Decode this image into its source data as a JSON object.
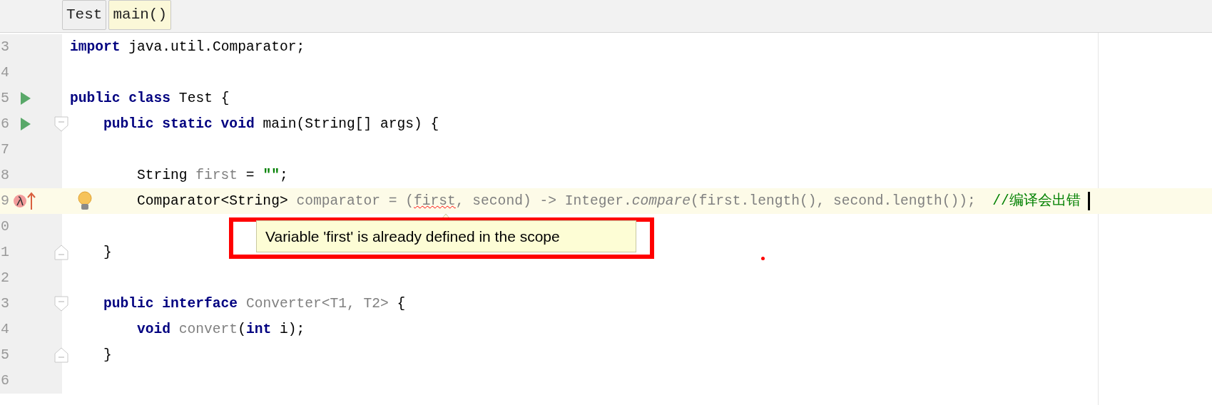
{
  "breadcrumbs": [
    {
      "label": "Test",
      "selected": false
    },
    {
      "label": "main()",
      "selected": true
    }
  ],
  "lines": [
    {
      "number": "3",
      "current": false,
      "tokens": [
        {
          "kind": "keyword",
          "text": "import"
        },
        {
          "kind": "plain",
          "text": " java.util.Comparator;"
        }
      ]
    },
    {
      "number": "4",
      "current": false
    },
    {
      "number": "5",
      "current": false,
      "gutter": [
        {
          "kind": "run"
        }
      ],
      "tokens": [
        {
          "kind": "keyword",
          "text": "public class"
        },
        {
          "kind": "plain",
          "text": " Test {"
        }
      ],
      "children": [
        {
          "number": "6",
          "current": false,
          "gutter": [
            {
              "kind": "run"
            },
            {
              "kind": "fold_start"
            }
          ],
          "tokens": [
            {
              "kind": "keyword",
              "text": "public static void"
            },
            {
              "kind": "plain",
              "text": " main(String[] args) {"
            }
          ],
          "children": [
            {
              "number": "7",
              "current": false
            },
            {
              "number": "8",
              "current": false,
              "tokens": [
                {
                  "kind": "plain",
                  "text": "String "
                },
                {
                  "kind": "unused",
                  "text": "first"
                },
                {
                  "kind": "plain",
                  "text": " = "
                },
                {
                  "kind": "string",
                  "text": "\"\""
                },
                {
                  "kind": "plain",
                  "text": ";"
                }
              ]
            },
            {
              "number": "9",
              "current": true,
              "gutter": [
                {
                  "kind": "lambda"
                },
                {
                  "kind": "arrow"
                }
              ],
              "bulb": true,
              "caret": true,
              "tokens": [
                {
                  "kind": "plain",
                  "text": "Comparator<String> "
                },
                {
                  "kind": "unused",
                  "text": "comparator = ("
                },
                {
                  "kind": "error",
                  "text": "first"
                },
                {
                  "kind": "unused",
                  "text": ", second) -> Integer."
                },
                {
                  "kind": "italic",
                  "text": "compare"
                },
                {
                  "kind": "unused",
                  "text": "(first.length(), second.length());"
                },
                {
                  "kind": "comment",
                  "text": "  //编译会出错"
                }
              ]
            },
            {
              "number": "0",
              "current": false
            }
          ]
        },
        {
          "number": "1",
          "current": false,
          "gutter": [
            {
              "kind": "fold_end"
            }
          ],
          "tokens": [
            {
              "kind": "plain",
              "text": "}"
            }
          ]
        },
        {
          "number": "2",
          "current": false
        },
        {
          "number": "3",
          "current": false,
          "gutter": [
            {
              "kind": "fold_start"
            }
          ],
          "tokens": [
            {
              "kind": "keyword",
              "text": "public interface"
            },
            {
              "kind": "unused",
              "text": " Converter<T1, T2>"
            },
            {
              "kind": "plain",
              "text": " {"
            }
          ],
          "children": [
            {
              "number": "4",
              "current": false,
              "tokens": [
                {
                  "kind": "keyword",
                  "text": "void"
                },
                {
                  "kind": "unused",
                  "text": " convert"
                },
                {
                  "kind": "plain",
                  "text": "("
                },
                {
                  "kind": "keyword",
                  "text": "int"
                },
                {
                  "kind": "plain",
                  "text": " i);"
                }
              ]
            }
          ]
        },
        {
          "number": "5",
          "current": false,
          "gutter": [
            {
              "kind": "fold_end"
            }
          ],
          "tokens": [
            {
              "kind": "plain",
              "text": "}"
            }
          ]
        },
        {
          "number": "6",
          "current": false
        }
      ]
    }
  ],
  "tooltip": {
    "text": "Variable 'first' is already defined in the scope"
  }
}
